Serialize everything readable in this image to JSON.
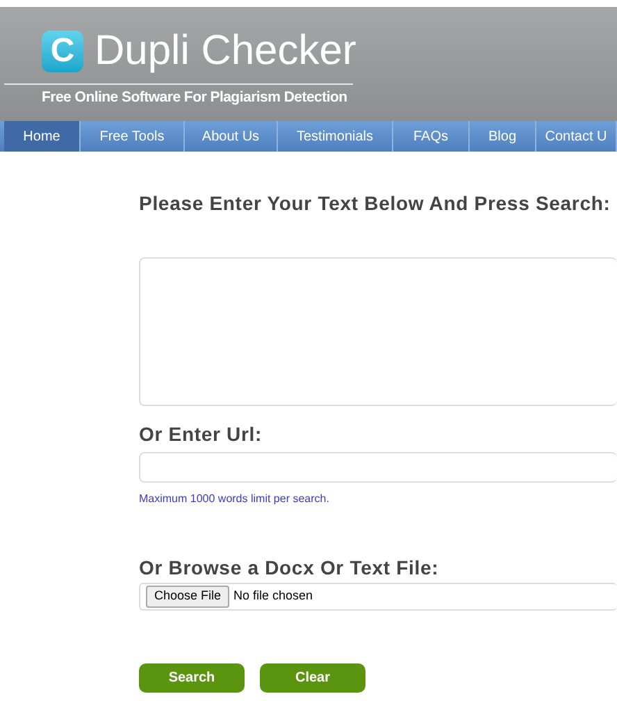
{
  "header": {
    "logo_letter": "C",
    "title": "Dupli Checker",
    "tagline": "Free Online Software For Plagiarism Detection"
  },
  "nav": [
    {
      "label": "Home",
      "selected": true
    },
    {
      "label": "Free Tools",
      "selected": false
    },
    {
      "label": "About Us",
      "selected": false
    },
    {
      "label": "Testimonials",
      "selected": false
    },
    {
      "label": "FAQs",
      "selected": false
    },
    {
      "label": "Blog",
      "selected": false
    },
    {
      "label": "Contact U",
      "selected": false
    }
  ],
  "main": {
    "heading": "Please Enter Your Text Below And Press Search:",
    "url_heading": "Or Enter Url:",
    "limit_note": "Maximum 1000 words limit per search.",
    "file_heading": "Or Browse a Docx Or Text File:",
    "choose_file": "Choose File",
    "file_status": "No file chosen"
  },
  "buttons": [
    "Search",
    "Clear"
  ]
}
